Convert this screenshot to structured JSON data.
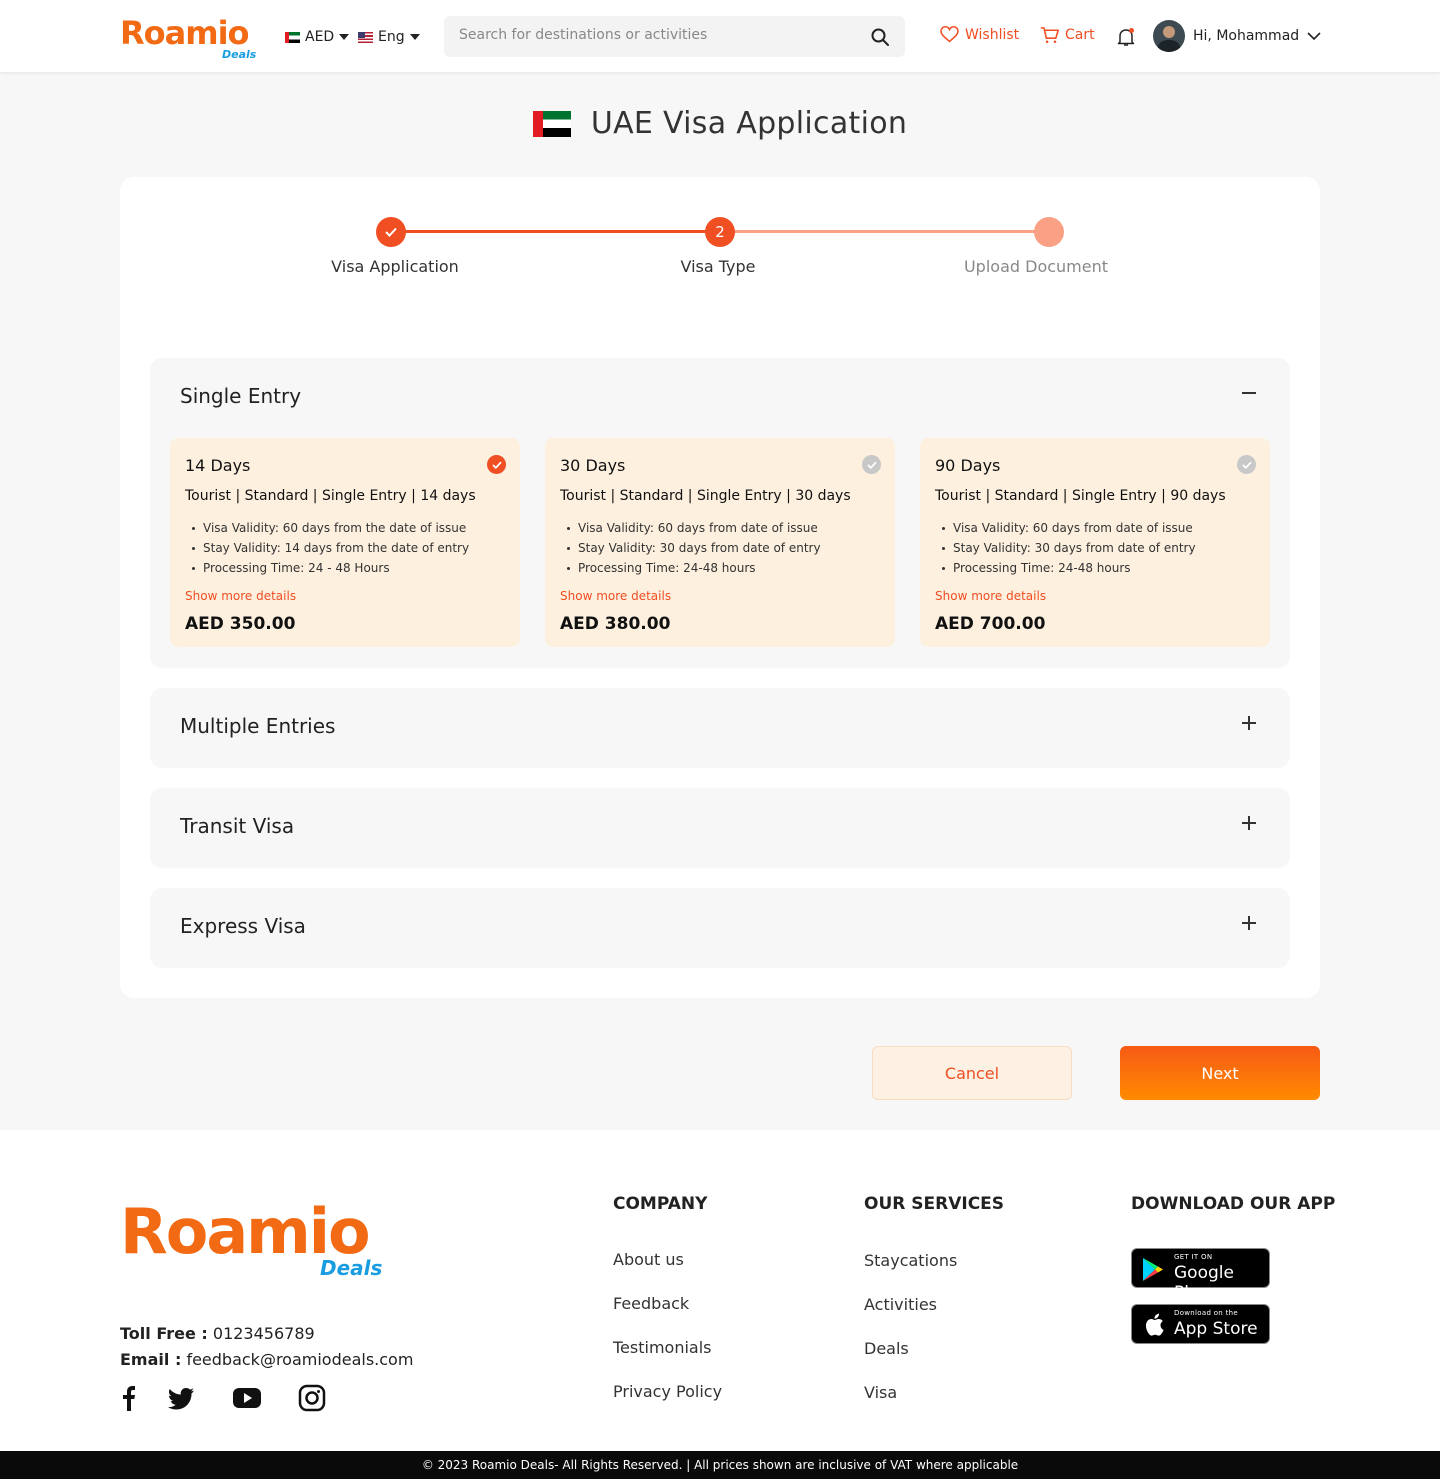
{
  "header": {
    "logo_text": "Roamio",
    "logo_sub": "Deals",
    "currency": "AED",
    "language": "Eng",
    "search_placeholder": "Search for destinations or activities",
    "wishlist": "Wishlist",
    "cart": "Cart",
    "greeting": "Hi, Mohammad"
  },
  "page_title": "UAE Visa Application",
  "stepper": {
    "steps": [
      {
        "label": "Visa Application",
        "state": "done"
      },
      {
        "label": "Visa Type",
        "state": "current",
        "number": "2"
      },
      {
        "label": "Upload Document",
        "state": "pending"
      }
    ]
  },
  "panels": [
    {
      "title": "Single Entry",
      "expanded": true,
      "options": [
        {
          "name": "14 Days",
          "subtitle": "Tourist | Standard | Single Entry | 14 days",
          "details": [
            "Visa Validity: 60 days from the date of issue",
            "Stay Validity: 14 days from the date of entry",
            "Processing Time: 24 - 48 Hours"
          ],
          "more": "Show more details",
          "price": "AED 350.00",
          "selected": true
        },
        {
          "name": "30 Days",
          "subtitle": "Tourist | Standard | Single Entry | 30 days",
          "details": [
            "Visa Validity: 60 days from date of issue",
            "Stay Validity: 30 days from date of entry",
            "Processing Time: 24-48 hours"
          ],
          "more": "Show more details",
          "price": "AED 380.00",
          "selected": false
        },
        {
          "name": "90 Days",
          "subtitle": "Tourist | Standard | Single Entry | 90 days",
          "details": [
            "Visa Validity: 60 days from date of issue",
            "Stay Validity: 30 days from date of entry",
            "Processing Time: 24-48 hours"
          ],
          "more": "Show more details",
          "price": "AED 700.00",
          "selected": false
        }
      ]
    },
    {
      "title": "Multiple Entries",
      "expanded": false
    },
    {
      "title": "Transit Visa",
      "expanded": false
    },
    {
      "title": "Express Visa",
      "expanded": false
    }
  ],
  "actions": {
    "cancel": "Cancel",
    "next": "Next"
  },
  "footer": {
    "logo_text": "Roamio",
    "logo_sub": "Deals",
    "toll_free_label": "Toll Free :",
    "toll_free": "0123456789",
    "email_label": "Email :",
    "email": "feedback@roamiodeals.com",
    "social": [
      "facebook-icon",
      "twitter-icon",
      "youtube-icon",
      "instagram-icon"
    ],
    "company": {
      "heading": "COMPANY",
      "links": [
        "About us",
        "Feedback",
        "Testimonials",
        "Privacy Policy"
      ]
    },
    "services": {
      "heading": "OUR SERVICES",
      "links": [
        "Staycations",
        "Activities",
        "Deals",
        "Visa"
      ]
    },
    "apps": {
      "heading": "DOWNLOAD OUR APP",
      "google_small": "GET IT ON",
      "google_big": "Google Play",
      "apple_small": "Download on the",
      "apple_big": "App Store"
    },
    "copyright": "© 2023 Roamio Deals- All Rights Reserved. | All prices shown are inclusive of VAT where applicable"
  },
  "colors": {
    "accent": "#f04e23",
    "orange": "#ff7a00",
    "card_bg": "#fdf0df"
  }
}
